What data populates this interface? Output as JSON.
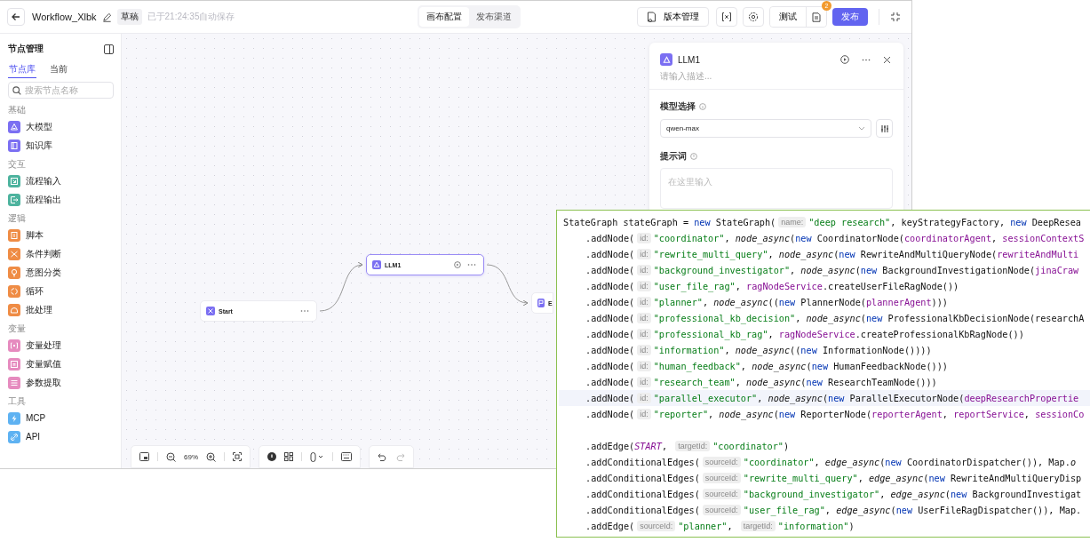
{
  "header": {
    "title": "Workflow_Xlbk",
    "status_badge": "草稿",
    "autosave": "已于21:24:35自动保存",
    "view_tabs": [
      {
        "label": "画布配置",
        "selected": true
      },
      {
        "label": "发布渠道",
        "selected": false
      }
    ],
    "version_button": "版本管理",
    "test_button": "测试",
    "notification_count": "2",
    "publish_button": "发布"
  },
  "sidebar": {
    "title": "节点管理",
    "tabs": [
      {
        "label": "节点库",
        "selected": true
      },
      {
        "label": "当前",
        "selected": false
      }
    ],
    "search": {
      "placeholder": "搜索节点名称"
    },
    "groups": [
      {
        "title": "基础",
        "items": [
          {
            "label": "大模型",
            "kind": "llm",
            "color": "#7b6ff2"
          },
          {
            "label": "知识库",
            "kind": "book",
            "color": "#7b6ff2"
          }
        ]
      },
      {
        "title": "交互",
        "items": [
          {
            "label": "流程输入",
            "kind": "input",
            "color": "#4db39e"
          },
          {
            "label": "流程输出",
            "kind": "output",
            "color": "#4db39e"
          }
        ]
      },
      {
        "title": "逻辑",
        "items": [
          {
            "label": "脚本",
            "kind": "script",
            "color": "#ef8c45"
          },
          {
            "label": "条件判断",
            "kind": "branch",
            "color": "#ef8c45"
          },
          {
            "label": "意图分类",
            "kind": "bulb",
            "color": "#ef8c45"
          },
          {
            "label": "循环",
            "kind": "loop",
            "color": "#ef8c45"
          },
          {
            "label": "批处理",
            "kind": "batch",
            "color": "#ef8c45"
          }
        ]
      },
      {
        "title": "变量",
        "items": [
          {
            "label": "变量处理",
            "kind": "variable",
            "color": "#e68bbf"
          },
          {
            "label": "变量赋值",
            "kind": "assign",
            "color": "#e68bbf"
          },
          {
            "label": "参数提取",
            "kind": "extract",
            "color": "#e68bbf"
          }
        ]
      },
      {
        "title": "工具",
        "items": [
          {
            "label": "MCP",
            "kind": "bolt",
            "color": "#5eb2f2"
          },
          {
            "label": "API",
            "kind": "link",
            "color": "#5eb2f2"
          }
        ]
      }
    ]
  },
  "canvas": {
    "nodes": [
      {
        "label": "Start",
        "kind": "start",
        "selected": false
      },
      {
        "label": "LLM1",
        "kind": "llm",
        "selected": true
      },
      {
        "label": "E",
        "kind": "end",
        "selected": false
      }
    ],
    "zoom": "69%"
  },
  "panel": {
    "title": "LLM1",
    "description_placeholder": "请输入描述...",
    "model_label": "模型选择",
    "model_value": "qwen-max",
    "prompt_label": "提示词",
    "prompt_placeholder": "在这里输入"
  },
  "code": {
    "lines": [
      {
        "indent": false,
        "highlighted": false,
        "gap_before": false,
        "tokens": [
          {
            "kind": "plain",
            "text": "StateGraph stateGraph = "
          },
          {
            "kind": "keyword",
            "text": "new"
          },
          {
            "kind": "plain",
            "text": " StateGraph("
          },
          {
            "kind": "hint",
            "text": "name:"
          },
          {
            "kind": "string",
            "text": "\"deep research\""
          },
          {
            "kind": "plain",
            "text": ", keyStrategyFactory, "
          },
          {
            "kind": "keyword",
            "text": "new"
          },
          {
            "kind": "plain",
            "text": " DeepResea"
          }
        ]
      },
      {
        "indent": true,
        "highlighted": false,
        "gap_before": false,
        "tokens": [
          {
            "kind": "plain",
            "text": ".addNode("
          },
          {
            "kind": "hint",
            "text": "id:"
          },
          {
            "kind": "string",
            "text": "\"coordinator\""
          },
          {
            "kind": "plain",
            "text": ", "
          },
          {
            "kind": "call",
            "text": "node_async"
          },
          {
            "kind": "plain",
            "text": "("
          },
          {
            "kind": "keyword",
            "text": "new"
          },
          {
            "kind": "plain",
            "text": " CoordinatorNode("
          },
          {
            "kind": "field",
            "text": "coordinatorAgent"
          },
          {
            "kind": "plain",
            "text": ", "
          },
          {
            "kind": "field",
            "text": "sessionContextS"
          }
        ]
      },
      {
        "indent": true,
        "highlighted": false,
        "gap_before": false,
        "tokens": [
          {
            "kind": "plain",
            "text": ".addNode("
          },
          {
            "kind": "hint",
            "text": "id:"
          },
          {
            "kind": "string",
            "text": "\"rewrite_multi_query\""
          },
          {
            "kind": "plain",
            "text": ", "
          },
          {
            "kind": "call",
            "text": "node_async"
          },
          {
            "kind": "plain",
            "text": "("
          },
          {
            "kind": "keyword",
            "text": "new"
          },
          {
            "kind": "plain",
            "text": " RewriteAndMultiQueryNode("
          },
          {
            "kind": "field",
            "text": "rewriteAndMulti"
          }
        ]
      },
      {
        "indent": true,
        "highlighted": false,
        "gap_before": false,
        "tokens": [
          {
            "kind": "plain",
            "text": ".addNode("
          },
          {
            "kind": "hint",
            "text": "id:"
          },
          {
            "kind": "string",
            "text": "\"background_investigator\""
          },
          {
            "kind": "plain",
            "text": ", "
          },
          {
            "kind": "call",
            "text": "node_async"
          },
          {
            "kind": "plain",
            "text": "("
          },
          {
            "kind": "keyword",
            "text": "new"
          },
          {
            "kind": "plain",
            "text": " BackgroundInvestigationNode("
          },
          {
            "kind": "field",
            "text": "jinaCraw"
          }
        ]
      },
      {
        "indent": true,
        "highlighted": false,
        "gap_before": false,
        "tokens": [
          {
            "kind": "plain",
            "text": ".addNode("
          },
          {
            "kind": "hint",
            "text": "id:"
          },
          {
            "kind": "string",
            "text": "\"user_file_rag\""
          },
          {
            "kind": "plain",
            "text": ", "
          },
          {
            "kind": "field",
            "text": "ragNodeService"
          },
          {
            "kind": "plain",
            "text": ".createUserFileRagNode())"
          }
        ]
      },
      {
        "indent": true,
        "highlighted": false,
        "gap_before": false,
        "tokens": [
          {
            "kind": "plain",
            "text": ".addNode("
          },
          {
            "kind": "hint",
            "text": "id:"
          },
          {
            "kind": "string",
            "text": "\"planner\""
          },
          {
            "kind": "plain",
            "text": ", "
          },
          {
            "kind": "call",
            "text": "node_async"
          },
          {
            "kind": "plain",
            "text": "(("
          },
          {
            "kind": "keyword",
            "text": "new"
          },
          {
            "kind": "plain",
            "text": " PlannerNode("
          },
          {
            "kind": "field",
            "text": "plannerAgent"
          },
          {
            "kind": "plain",
            "text": ")))"
          }
        ]
      },
      {
        "indent": true,
        "highlighted": false,
        "gap_before": false,
        "tokens": [
          {
            "kind": "plain",
            "text": ".addNode("
          },
          {
            "kind": "hint",
            "text": "id:"
          },
          {
            "kind": "string",
            "text": "\"professional_kb_decision\""
          },
          {
            "kind": "plain",
            "text": ", "
          },
          {
            "kind": "call",
            "text": "node_async"
          },
          {
            "kind": "plain",
            "text": "("
          },
          {
            "kind": "keyword",
            "text": "new"
          },
          {
            "kind": "plain",
            "text": " ProfessionalKbDecisionNode(researchA"
          }
        ]
      },
      {
        "indent": true,
        "highlighted": false,
        "gap_before": false,
        "tokens": [
          {
            "kind": "plain",
            "text": ".addNode("
          },
          {
            "kind": "hint",
            "text": "id:"
          },
          {
            "kind": "string",
            "text": "\"professional_kb_rag\""
          },
          {
            "kind": "plain",
            "text": ", "
          },
          {
            "kind": "field",
            "text": "ragNodeService"
          },
          {
            "kind": "plain",
            "text": ".createProfessionalKbRagNode())"
          }
        ]
      },
      {
        "indent": true,
        "highlighted": false,
        "gap_before": false,
        "tokens": [
          {
            "kind": "plain",
            "text": ".addNode("
          },
          {
            "kind": "hint",
            "text": "id:"
          },
          {
            "kind": "string",
            "text": "\"information\""
          },
          {
            "kind": "plain",
            "text": ", "
          },
          {
            "kind": "call",
            "text": "node_async"
          },
          {
            "kind": "plain",
            "text": "(("
          },
          {
            "kind": "keyword",
            "text": "new"
          },
          {
            "kind": "plain",
            "text": " InformationNode())))"
          }
        ]
      },
      {
        "indent": true,
        "highlighted": false,
        "gap_before": false,
        "tokens": [
          {
            "kind": "plain",
            "text": ".addNode("
          },
          {
            "kind": "hint",
            "text": "id:"
          },
          {
            "kind": "string",
            "text": "\"human_feedback\""
          },
          {
            "kind": "plain",
            "text": ", "
          },
          {
            "kind": "call",
            "text": "node_async"
          },
          {
            "kind": "plain",
            "text": "("
          },
          {
            "kind": "keyword",
            "text": "new"
          },
          {
            "kind": "plain",
            "text": " HumanFeedbackNode()))"
          }
        ]
      },
      {
        "indent": true,
        "highlighted": false,
        "gap_before": false,
        "tokens": [
          {
            "kind": "plain",
            "text": ".addNode("
          },
          {
            "kind": "hint",
            "text": "id:"
          },
          {
            "kind": "string",
            "text": "\"research_team\""
          },
          {
            "kind": "plain",
            "text": ", "
          },
          {
            "kind": "call",
            "text": "node_async"
          },
          {
            "kind": "plain",
            "text": "("
          },
          {
            "kind": "keyword",
            "text": "new"
          },
          {
            "kind": "plain",
            "text": " ResearchTeamNode()))"
          }
        ]
      },
      {
        "indent": true,
        "highlighted": true,
        "gap_before": false,
        "tokens": [
          {
            "kind": "plain",
            "text": ".addNode("
          },
          {
            "kind": "hint",
            "text": "id:"
          },
          {
            "kind": "string",
            "text": "\"parallel_executor\""
          },
          {
            "kind": "plain",
            "text": ", "
          },
          {
            "kind": "call",
            "text": "node_async"
          },
          {
            "kind": "plain",
            "text": "("
          },
          {
            "kind": "keyword",
            "text": "new"
          },
          {
            "kind": "plain",
            "text": " ParallelExecutorNode("
          },
          {
            "kind": "field",
            "text": "deepResearchPropertie"
          }
        ]
      },
      {
        "indent": true,
        "highlighted": false,
        "gap_before": false,
        "tokens": [
          {
            "kind": "plain",
            "text": ".addNode("
          },
          {
            "kind": "hint",
            "text": "id:"
          },
          {
            "kind": "string",
            "text": "\"reporter\""
          },
          {
            "kind": "plain",
            "text": ", "
          },
          {
            "kind": "call",
            "text": "node_async"
          },
          {
            "kind": "plain",
            "text": "("
          },
          {
            "kind": "keyword",
            "text": "new"
          },
          {
            "kind": "plain",
            "text": " ReporterNode("
          },
          {
            "kind": "field",
            "text": "reporterAgent"
          },
          {
            "kind": "plain",
            "text": ", "
          },
          {
            "kind": "field",
            "text": "reportService"
          },
          {
            "kind": "plain",
            "text": ", "
          },
          {
            "kind": "field",
            "text": "sessionCo"
          }
        ]
      },
      {
        "indent": true,
        "highlighted": false,
        "gap_before": true,
        "tokens": [
          {
            "kind": "plain",
            "text": ".addEdge("
          },
          {
            "kind": "constant",
            "text": "START"
          },
          {
            "kind": "plain",
            "text": ", "
          },
          {
            "kind": "hint",
            "text": "targetId:"
          },
          {
            "kind": "string",
            "text": "\"coordinator\""
          },
          {
            "kind": "plain",
            "text": ")"
          }
        ]
      },
      {
        "indent": true,
        "highlighted": false,
        "gap_before": false,
        "tokens": [
          {
            "kind": "plain",
            "text": ".addConditionalEdges("
          },
          {
            "kind": "hint",
            "text": "sourceId:"
          },
          {
            "kind": "string",
            "text": "\"coordinator\""
          },
          {
            "kind": "plain",
            "text": ", "
          },
          {
            "kind": "call",
            "text": "edge_async"
          },
          {
            "kind": "plain",
            "text": "("
          },
          {
            "kind": "keyword",
            "text": "new"
          },
          {
            "kind": "plain",
            "text": " CoordinatorDispatcher()), Map."
          },
          {
            "kind": "call",
            "text": "o"
          }
        ]
      },
      {
        "indent": true,
        "highlighted": false,
        "gap_before": false,
        "tokens": [
          {
            "kind": "plain",
            "text": ".addConditionalEdges("
          },
          {
            "kind": "hint",
            "text": "sourceId:"
          },
          {
            "kind": "string",
            "text": "\"rewrite_multi_query\""
          },
          {
            "kind": "plain",
            "text": ", "
          },
          {
            "kind": "call",
            "text": "edge_async"
          },
          {
            "kind": "plain",
            "text": "("
          },
          {
            "kind": "keyword",
            "text": "new"
          },
          {
            "kind": "plain",
            "text": " RewriteAndMultiQueryDisp"
          }
        ]
      },
      {
        "indent": true,
        "highlighted": false,
        "gap_before": false,
        "tokens": [
          {
            "kind": "plain",
            "text": ".addConditionalEdges("
          },
          {
            "kind": "hint",
            "text": "sourceId:"
          },
          {
            "kind": "string",
            "text": "\"background_investigator\""
          },
          {
            "kind": "plain",
            "text": ", "
          },
          {
            "kind": "call",
            "text": "edge_async"
          },
          {
            "kind": "plain",
            "text": "("
          },
          {
            "kind": "keyword",
            "text": "new"
          },
          {
            "kind": "plain",
            "text": " BackgroundInvestigat"
          }
        ]
      },
      {
        "indent": true,
        "highlighted": false,
        "gap_before": false,
        "tokens": [
          {
            "kind": "plain",
            "text": ".addConditionalEdges("
          },
          {
            "kind": "hint",
            "text": "sourceId:"
          },
          {
            "kind": "string",
            "text": "\"user_file_rag\""
          },
          {
            "kind": "plain",
            "text": ", "
          },
          {
            "kind": "call",
            "text": "edge_async"
          },
          {
            "kind": "plain",
            "text": "("
          },
          {
            "kind": "keyword",
            "text": "new"
          },
          {
            "kind": "plain",
            "text": " UserFileRagDispatcher()), Map."
          }
        ]
      },
      {
        "indent": true,
        "highlighted": false,
        "gap_before": false,
        "tokens": [
          {
            "kind": "plain",
            "text": ".addEdge("
          },
          {
            "kind": "hint",
            "text": "sourceId:"
          },
          {
            "kind": "string",
            "text": "\"planner\""
          },
          {
            "kind": "plain",
            "text": ", "
          },
          {
            "kind": "hint",
            "text": "targetId:"
          },
          {
            "kind": "string",
            "text": "\"information\""
          },
          {
            "kind": "plain",
            "text": ")"
          }
        ]
      }
    ]
  }
}
